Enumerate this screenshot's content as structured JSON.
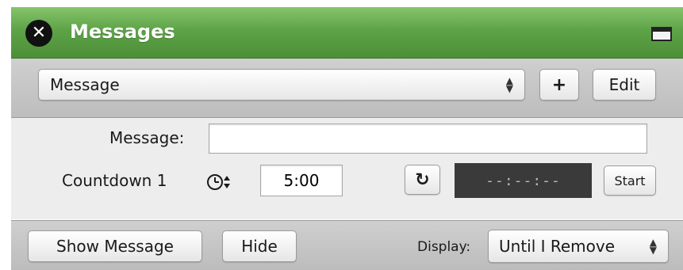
{
  "window": {
    "title": "Messages",
    "close_icon": "close-x-icon",
    "window_icon": "window-icon"
  },
  "toolbar": {
    "message_select": "Message",
    "add_label": "+",
    "edit_label": "Edit"
  },
  "form": {
    "message_label": "Message:",
    "message_value": "",
    "countdown_label": "Countdown 1",
    "countdown_value": "5:00",
    "timer_display": "--:--:--",
    "start_label": "Start",
    "reset_icon": "reset-icon",
    "clock_icon": "clock-icon"
  },
  "footer": {
    "show_label": "Show Message",
    "hide_label": "Hide",
    "display_label": "Display:",
    "display_value": "Until I Remove"
  },
  "colors": {
    "title_green": "#5ea348",
    "timer_bg": "#3a3a3a"
  }
}
